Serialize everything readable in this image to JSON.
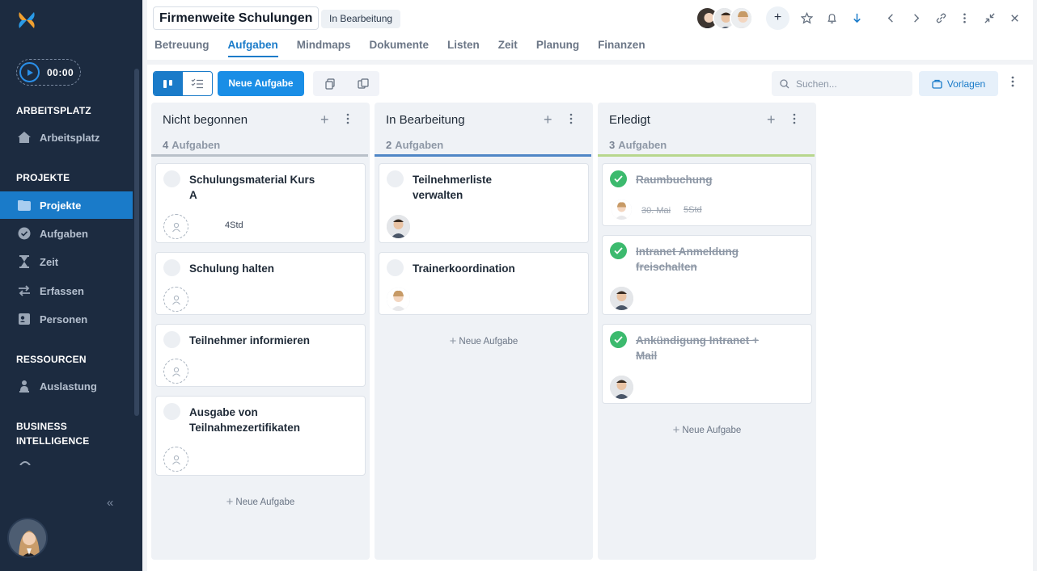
{
  "sidebar": {
    "timer": "00:00",
    "sections": {
      "arbeitsplatz": "ARBEITSPLATZ",
      "projekte": "PROJEKTE",
      "ressourcen": "RESSOURCEN",
      "bi_line1": "BUSINESS",
      "bi_line2": "INTELLIGENCE"
    },
    "items": [
      {
        "label": "Arbeitsplatz",
        "icon": "home-icon"
      },
      {
        "label": "Projekte",
        "icon": "folder-icon",
        "active": true
      },
      {
        "label": "Aufgaben",
        "icon": "check-circle-icon"
      },
      {
        "label": "Zeit",
        "icon": "hourglass-icon"
      },
      {
        "label": "Erfassen",
        "icon": "swap-icon"
      },
      {
        "label": "Personen",
        "icon": "contact-card-icon"
      },
      {
        "label": "Auslastung",
        "icon": "person-load-icon"
      }
    ]
  },
  "header": {
    "title": "Firmenweite Schulungen",
    "status": "In Bearbeitung",
    "add_member": "+",
    "tabs": [
      "Betreuung",
      "Aufgaben",
      "Mindmaps",
      "Dokumente",
      "Listen",
      "Zeit",
      "Planung",
      "Finanzen"
    ],
    "active_tab": "Aufgaben"
  },
  "toolbar": {
    "new_task": "Neue Aufgabe",
    "search_placeholder": "Suchen...",
    "templates": "Vorlagen"
  },
  "board": {
    "count_label": "Aufgaben",
    "new_task_label": "Neue Aufgabe",
    "columns": [
      {
        "title": "Nicht begonnen",
        "count": "4",
        "color": "#b9c0c9",
        "cards": [
          {
            "line1": "Schulungsmaterial Kurs",
            "line2": "A",
            "meta": "4Std"
          },
          {
            "line1": "Schulung halten",
            "line2": ""
          },
          {
            "line1": "Teilnehmer informieren",
            "line2": ""
          },
          {
            "line1": "Ausgabe von",
            "line2": "Teilnahmezertifikaten"
          }
        ]
      },
      {
        "title": "In Bearbeitung",
        "count": "2",
        "color": "#4f86c6",
        "cards": [
          {
            "line1": "Teilnehmerliste",
            "line2": "verwalten"
          },
          {
            "line1": "Trainerkoordination",
            "line2": ""
          }
        ]
      },
      {
        "title": "Erledigt",
        "count": "3",
        "color": "#b7d78d",
        "cards": [
          {
            "line1": "Raumbuchung",
            "line2": "",
            "date": "30. Mai",
            "meta": "5Std"
          },
          {
            "line1": "Intranet Anmeldung",
            "line2": "freischalten"
          },
          {
            "line1": "Ankündigung Intranet +",
            "line2": "Mail"
          }
        ]
      }
    ]
  }
}
